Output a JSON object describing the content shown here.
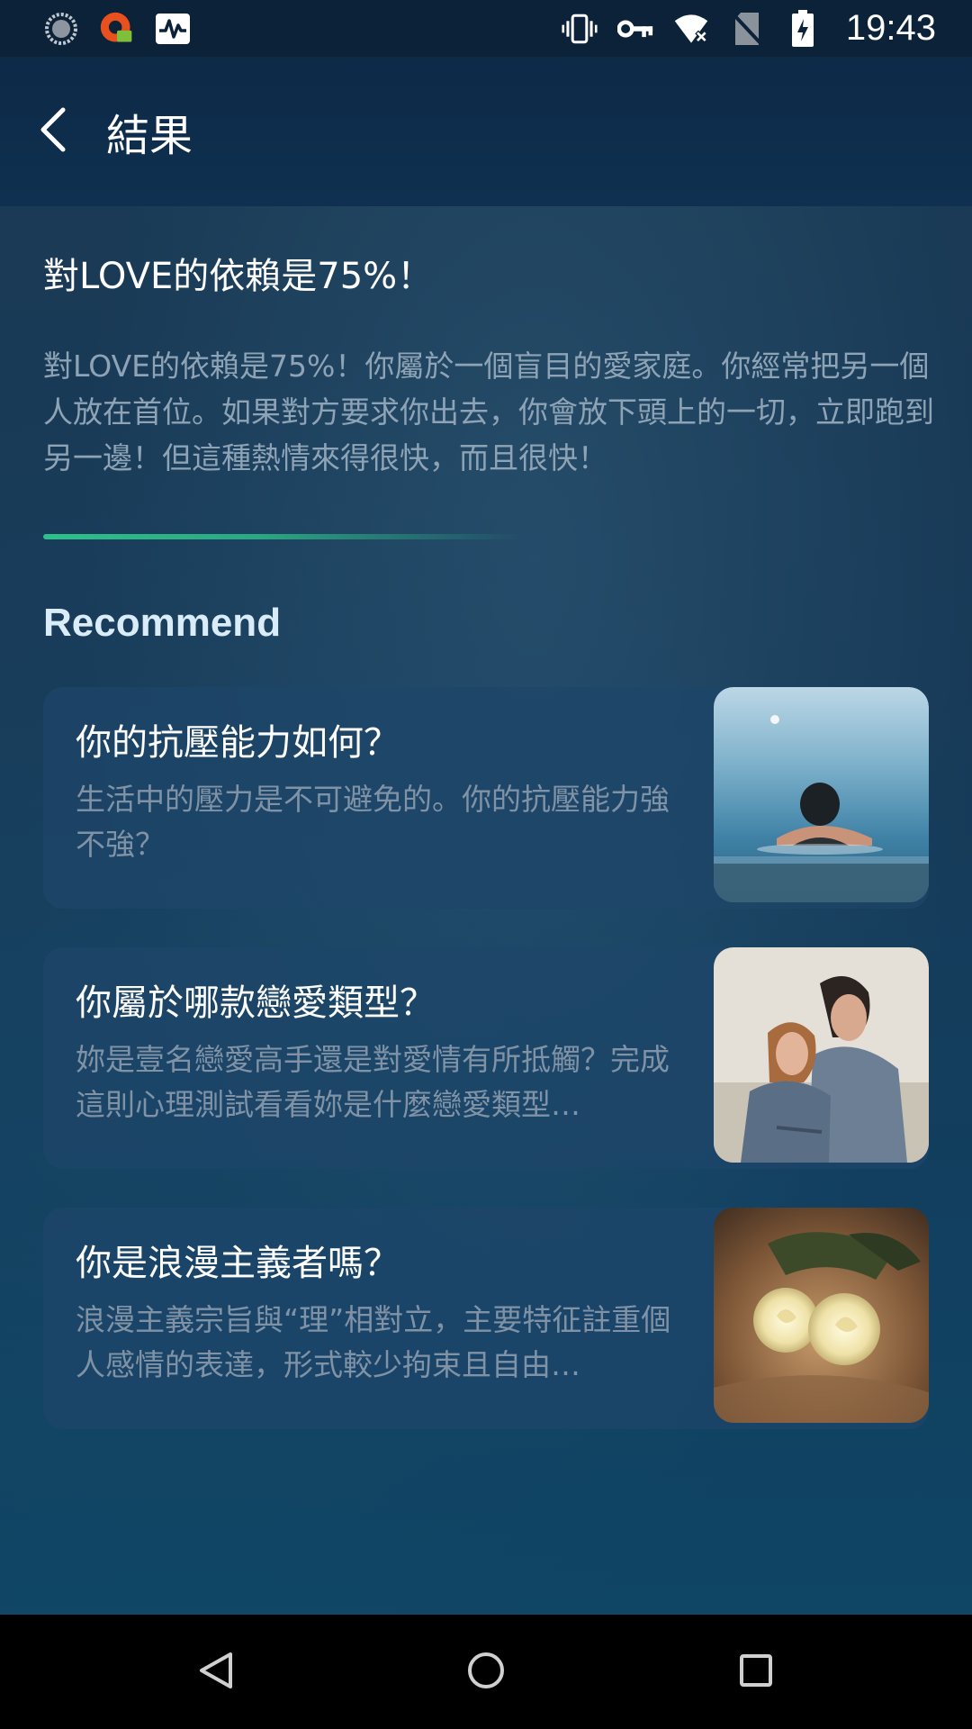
{
  "status_bar": {
    "time": "19:43",
    "left_icons": [
      "sync-icon",
      "app-notification-icon",
      "activity-monitor-icon"
    ],
    "right_icons": [
      "vibrate-icon",
      "vpn-key-icon",
      "wifi-off-icon",
      "no-sim-icon",
      "battery-charging-icon"
    ]
  },
  "app_bar": {
    "title": "結果",
    "back_icon": "chevron-left-icon"
  },
  "result": {
    "title": "對LOVE的依賴是75%！",
    "description": "對LOVE的依賴是75%！你屬於一個盲目的愛家庭。你經常把另一個人放在首位。如果對方要求你出去，你會放下頭上的一切，立即跑到另一邊！但這種熱情來得很快，而且很快！"
  },
  "recommend": {
    "heading": "Recommend",
    "items": [
      {
        "title": "你的抗壓能力如何？",
        "description": "生活中的壓力是不可避免的。你的抗壓能力強不強？",
        "thumbnail": "person-in-infinity-pool-image"
      },
      {
        "title": "你屬於哪款戀愛類型？",
        "description": "妳是壹名戀愛高手還是對愛情有所抵觸？完成這則心理測試看看妳是什麼戀愛類型…",
        "thumbnail": "couple-in-denim-jackets-image"
      },
      {
        "title": "你是浪漫主義者嗎？",
        "description": "浪漫主義宗旨與“理”相對立，主要特征註重個人感情的表達，形式較少拘束且自由…",
        "thumbnail": "white-roses-image"
      }
    ]
  },
  "nav_bar": {
    "buttons": [
      "back-triangle-icon",
      "home-circle-icon",
      "recents-square-icon"
    ]
  },
  "colors": {
    "accent_green": "#2cc18a",
    "heading_blue": "#d9ecf7",
    "muted_text": "#8ea3b5"
  }
}
